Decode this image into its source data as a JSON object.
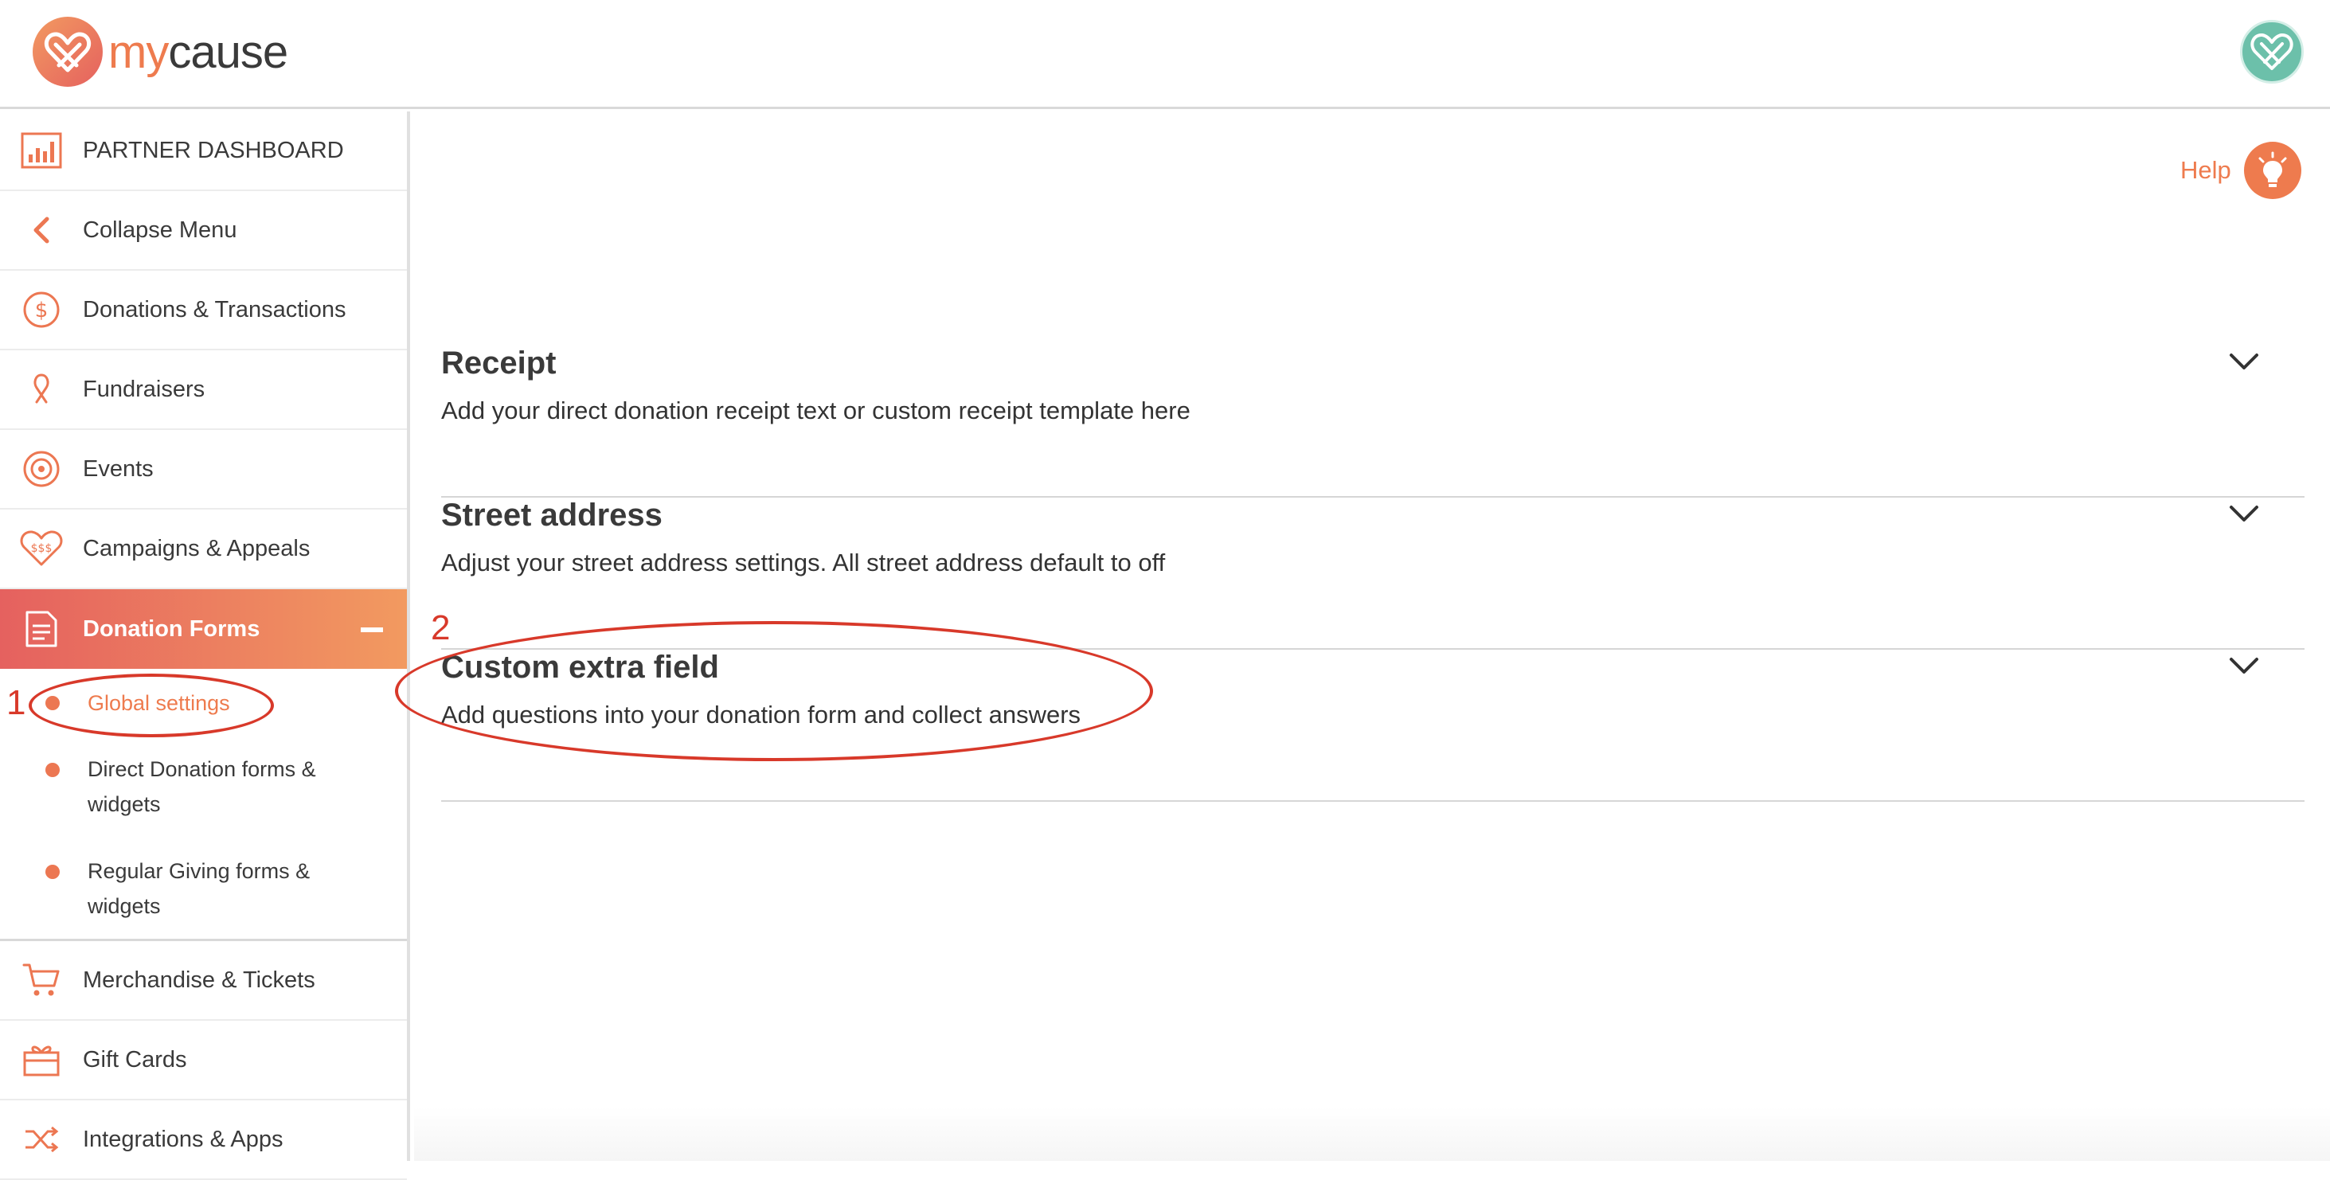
{
  "brand": {
    "logo_my": "my",
    "logo_cause": "cause",
    "accent": "#ee7b4e",
    "accent_gradient_start": "#e5615f",
    "accent_gradient_end": "#f29a60",
    "avatar_color": "#6cc0aa"
  },
  "sidebar": {
    "items": [
      {
        "label": "PARTNER DASHBOARD",
        "icon": "bar-chart-icon"
      },
      {
        "label": "Collapse Menu",
        "icon": "chevron-left-icon"
      },
      {
        "label": "Donations & Transactions",
        "icon": "dollar-circle-icon"
      },
      {
        "label": "Fundraisers",
        "icon": "ribbon-icon"
      },
      {
        "label": "Events",
        "icon": "target-icon"
      },
      {
        "label": "Campaigns & Appeals",
        "icon": "heart-dollar-icon"
      },
      {
        "label": "Donation Forms",
        "icon": "document-icon"
      },
      {
        "label": "Merchandise & Tickets",
        "icon": "cart-icon"
      },
      {
        "label": "Gift Cards",
        "icon": "gift-icon"
      },
      {
        "label": "Integrations & Apps",
        "icon": "shuffle-icon"
      }
    ],
    "donation_forms_sub": [
      {
        "label": "Global settings"
      },
      {
        "label": "Direct Donation forms & widgets"
      },
      {
        "label": "Regular Giving forms & widgets"
      }
    ]
  },
  "help": {
    "label": "Help",
    "icon": "lightbulb-icon"
  },
  "sections": [
    {
      "title": "Receipt",
      "description": "Add your direct donation receipt text or custom receipt template here"
    },
    {
      "title": "Street address",
      "description": "Adjust your street address settings. All street address default to off"
    },
    {
      "title": "Custom extra field",
      "description": "Add questions into your donation form and collect answers"
    }
  ],
  "annotations": {
    "one": "1",
    "two": "2",
    "color": "#d8392a"
  }
}
